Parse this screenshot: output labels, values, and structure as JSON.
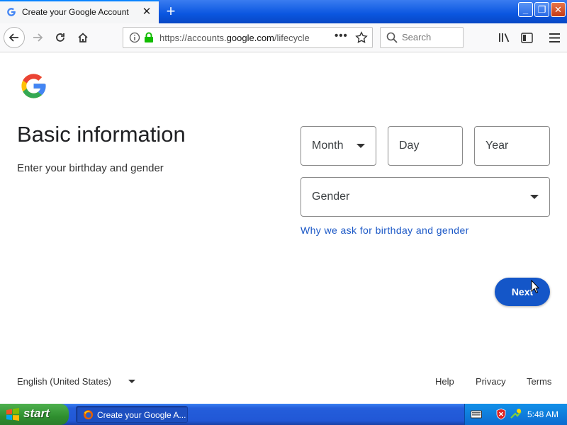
{
  "browser": {
    "tab_title": "Create your Google Account",
    "url_prefix": "https://accounts.",
    "url_domain": "google.com",
    "url_rest": "/lifecycle",
    "search_placeholder": "Search"
  },
  "page": {
    "title": "Basic information",
    "subtitle": "Enter your birthday and gender",
    "fields": {
      "month": "Month",
      "day": "Day",
      "year": "Year",
      "gender": "Gender"
    },
    "why_link": "Why we ask for birthday and gender",
    "next_label": "Next"
  },
  "footer": {
    "language": "English (United States)",
    "help": "Help",
    "privacy": "Privacy",
    "terms": "Terms"
  },
  "taskbar": {
    "start_label": "start",
    "task_label": "Create your Google A...",
    "clock": "5:48 AM"
  },
  "colors": {
    "google_blue": "#4285F4",
    "google_red": "#EA4335",
    "google_yellow": "#FBBC05",
    "google_green": "#34A853",
    "next_button": "#1456c8",
    "link": "#1a57c6"
  }
}
